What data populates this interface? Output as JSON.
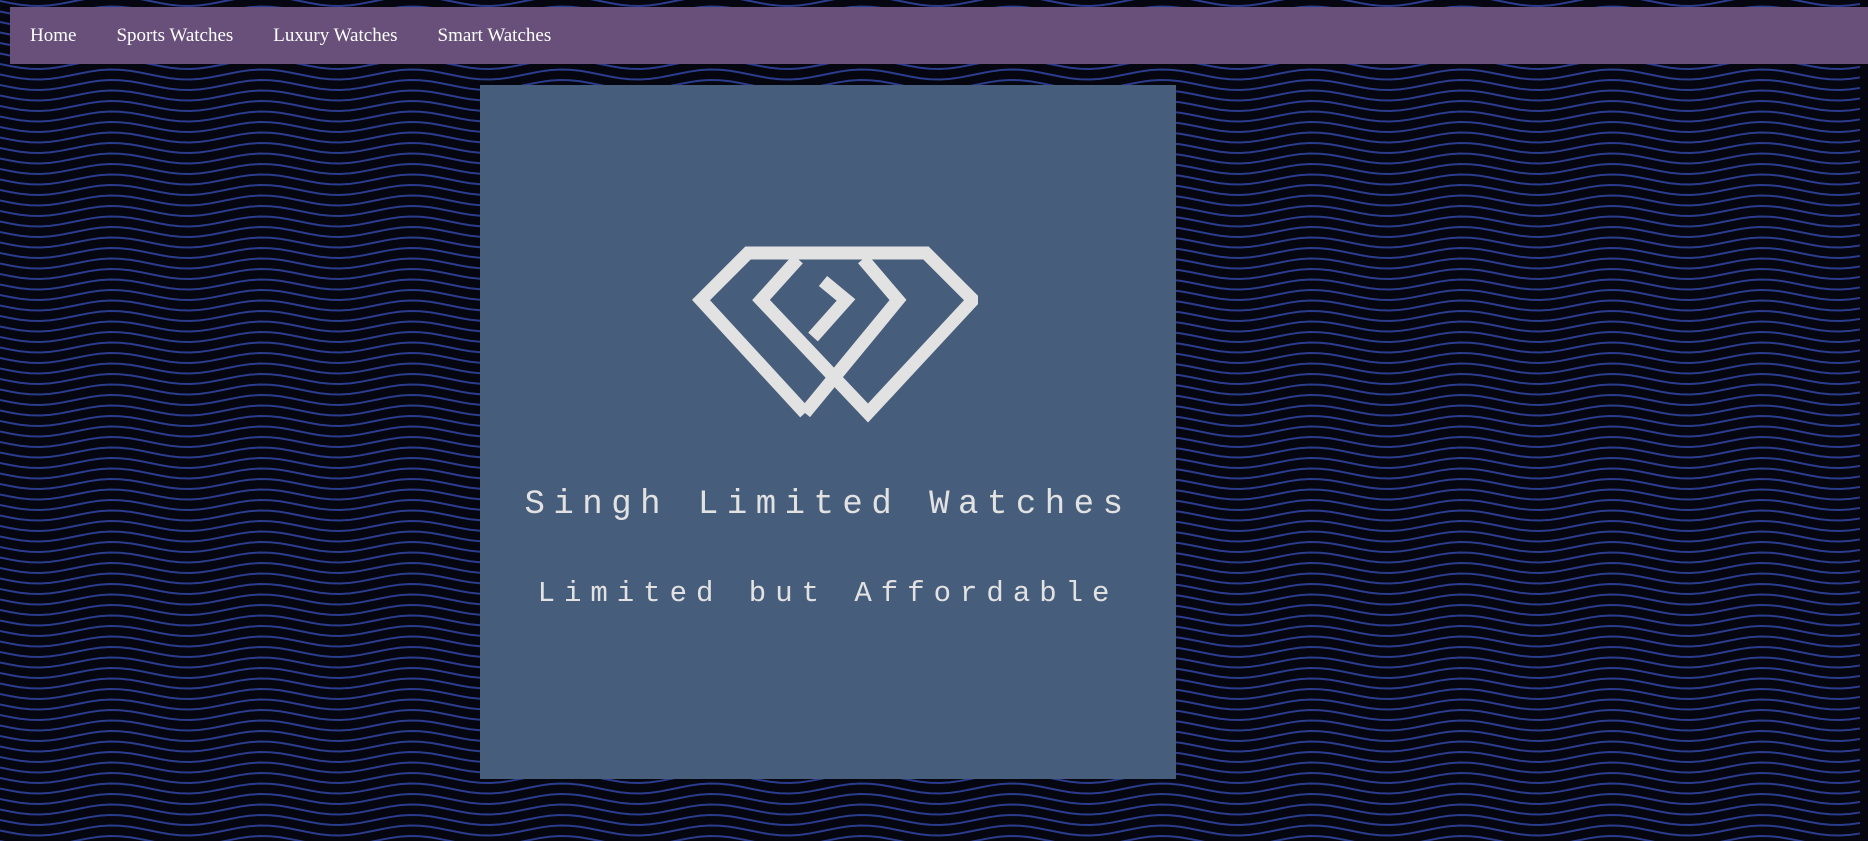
{
  "nav": {
    "items": [
      {
        "label": "Home"
      },
      {
        "label": "Sports Watches"
      },
      {
        "label": "Luxury Watches"
      },
      {
        "label": "Smart Watches"
      }
    ]
  },
  "hero": {
    "brand_name": "Singh Limited Watches",
    "tagline": "Limited but Affordable",
    "logo_icon": "diamond-logo-icon"
  },
  "colors": {
    "background": "#05060f",
    "wave_lines": "#2c3c8c",
    "navbar": "#68507a",
    "card": "#475d7c",
    "logo_text": "#e2e2e2"
  }
}
